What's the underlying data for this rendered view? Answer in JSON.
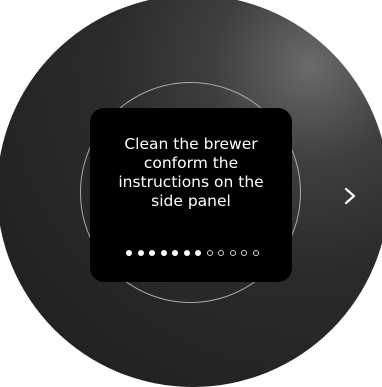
{
  "screen": {
    "message": "Clean the brewer\nconform the\ninstructions on the\nside panel"
  },
  "pagination": {
    "total": 12,
    "current": 7
  },
  "controls": {
    "next_icon": "chevron-right-icon"
  },
  "colors": {
    "dial": "#2b2b2b",
    "screen": "#000000",
    "ring": "#a9a9a9",
    "text": "#ffffff"
  }
}
